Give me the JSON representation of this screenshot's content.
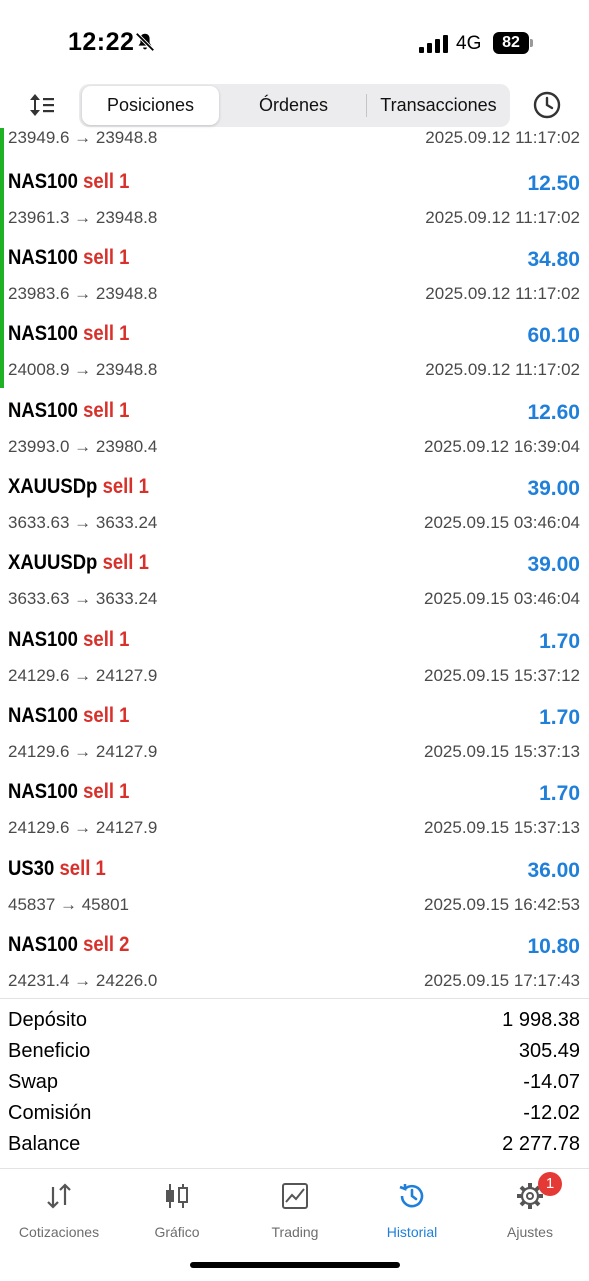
{
  "status": {
    "time": "12:22",
    "network": "4G",
    "battery": "82"
  },
  "tabs": [
    {
      "label": "Posiciones",
      "active": true
    },
    {
      "label": "Órdenes",
      "active": false
    },
    {
      "label": "Transacciones",
      "active": false
    }
  ],
  "partial_row": {
    "prices": "23949.6 → 23948.8",
    "time": "2025.09.12 11:17:02"
  },
  "deals": [
    {
      "symbol": "NAS100",
      "side": "sell 1",
      "profit": "12.50",
      "prices": "23961.3 → 23948.8",
      "time": "2025.09.12 11:17:02"
    },
    {
      "symbol": "NAS100",
      "side": "sell 1",
      "profit": "34.80",
      "prices": "23983.6 → 23948.8",
      "time": "2025.09.12 11:17:02"
    },
    {
      "symbol": "NAS100",
      "side": "sell 1",
      "profit": "60.10",
      "prices": "24008.9 → 23948.8",
      "time": "2025.09.12 11:17:02"
    },
    {
      "symbol": "NAS100",
      "side": "sell 1",
      "profit": "12.60",
      "prices": "23993.0 → 23980.4",
      "time": "2025.09.12 16:39:04"
    },
    {
      "symbol": "XAUUSDp",
      "side": "sell 1",
      "profit": "39.00",
      "prices": "3633.63 → 3633.24",
      "time": "2025.09.15 03:46:04"
    },
    {
      "symbol": "XAUUSDp",
      "side": "sell 1",
      "profit": "39.00",
      "prices": "3633.63 → 3633.24",
      "time": "2025.09.15 03:46:04"
    },
    {
      "symbol": "NAS100",
      "side": "sell 1",
      "profit": "1.70",
      "prices": "24129.6 → 24127.9",
      "time": "2025.09.15 15:37:12"
    },
    {
      "symbol": "NAS100",
      "side": "sell 1",
      "profit": "1.70",
      "prices": "24129.6 → 24127.9",
      "time": "2025.09.15 15:37:13"
    },
    {
      "symbol": "NAS100",
      "side": "sell 1",
      "profit": "1.70",
      "prices": "24129.6 → 24127.9",
      "time": "2025.09.15 15:37:13"
    },
    {
      "symbol": "US30",
      "side": "sell 1",
      "profit": "36.00",
      "prices": "45837 → 45801",
      "time": "2025.09.15 16:42:53"
    },
    {
      "symbol": "NAS100",
      "side": "sell 2",
      "profit": "10.80",
      "prices": "24231.4 → 24226.0",
      "time": "2025.09.15 17:17:43"
    }
  ],
  "summary": [
    {
      "label": "Depósito",
      "value": "1 998.38"
    },
    {
      "label": "Beneficio",
      "value": "305.49"
    },
    {
      "label": "Swap",
      "value": "-14.07"
    },
    {
      "label": "Comisión",
      "value": "-12.02"
    },
    {
      "label": "Balance",
      "value": "2 277.78"
    }
  ],
  "nav": [
    {
      "label": "Cotizaciones",
      "icon": "quotes-arrows-icon",
      "active": false
    },
    {
      "label": "Gráfico",
      "icon": "candlestick-icon",
      "active": false
    },
    {
      "label": "Trading",
      "icon": "trading-chart-icon",
      "active": false
    },
    {
      "label": "Historial",
      "icon": "history-icon",
      "active": true
    },
    {
      "label": "Ajustes",
      "icon": "gear-icon",
      "active": false,
      "badge": "1"
    }
  ],
  "colors": {
    "profit": "#1f7fd9",
    "sell": "#d8312b",
    "accent_bar": "#1fb125",
    "active_tab": "#1f7fd9",
    "badge": "#e53935"
  }
}
